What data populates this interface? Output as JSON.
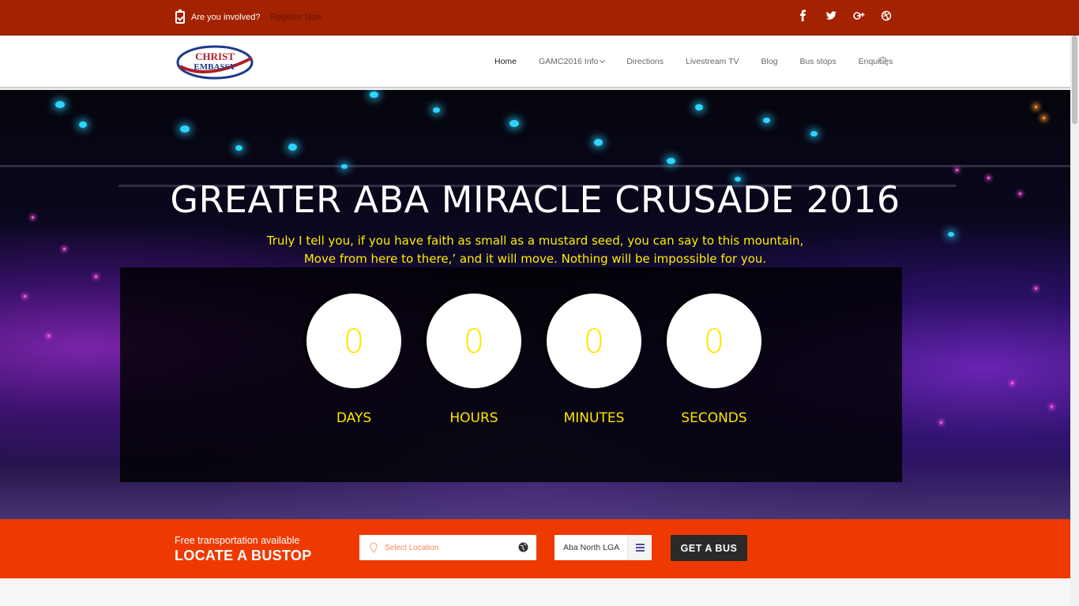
{
  "topbar": {
    "involved_text": "Are you involved?",
    "register_link": "Register Now",
    "social_icons": [
      "facebook-icon",
      "twitter-icon",
      "google-plus-icon",
      "dribbble-icon"
    ]
  },
  "header": {
    "logo_line1": "CHRIST",
    "logo_line2": "EMBASSY",
    "nav": [
      {
        "label": "Home"
      },
      {
        "label": "GAMC2016 Info"
      },
      {
        "label": "Directions"
      },
      {
        "label": "Livestream TV"
      },
      {
        "label": "Blog"
      },
      {
        "label": "Bus stops"
      },
      {
        "label": "Enquiries"
      }
    ]
  },
  "hero": {
    "title": "GREATER ABA MIRACLE CRUSADE 2016",
    "quote": "Truly I tell you, if you have faith as small as a mustard seed, you can say to this mountain, Move from here to there,’ and it will move. Nothing will be impossible for you."
  },
  "countdown": [
    {
      "value": "0",
      "label": "DAYS"
    },
    {
      "value": "0",
      "label": "HOURS"
    },
    {
      "value": "0",
      "label": "MINUTES"
    },
    {
      "value": "0",
      "label": "SECONDS"
    }
  ],
  "busbar": {
    "subtitle": "Free transportation available",
    "title": "LOCATE A BUSTOP",
    "location_placeholder": "Select Location",
    "lga_value": "Aba North LGA",
    "button_label": "GET A BUS"
  },
  "colors": {
    "topbar": "#a32200",
    "accent_orange": "#ee3a00",
    "countdown_yellow": "#ffe600"
  }
}
